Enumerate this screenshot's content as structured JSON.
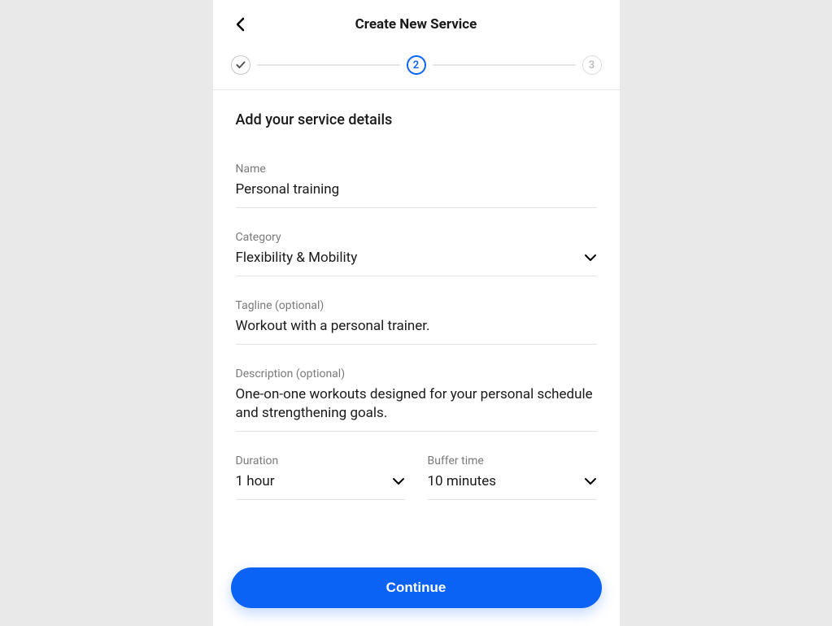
{
  "header": {
    "title": "Create New Service"
  },
  "stepper": {
    "step2_label": "2",
    "step3_label": "3"
  },
  "section_heading": "Add your service details",
  "fields": {
    "name": {
      "label": "Name",
      "value": "Personal training"
    },
    "category": {
      "label": "Category",
      "value": "Flexibility & Mobility"
    },
    "tagline": {
      "label": "Tagline (optional)",
      "value": "Workout with a personal trainer."
    },
    "description": {
      "label": "Description (optional)",
      "value": "One-on-one workouts designed for your personal schedule and strengthening goals."
    },
    "duration": {
      "label": "Duration",
      "value": "1 hour"
    },
    "buffer_time": {
      "label": "Buffer time",
      "value": "10 minutes"
    }
  },
  "footer": {
    "continue_label": "Continue"
  }
}
